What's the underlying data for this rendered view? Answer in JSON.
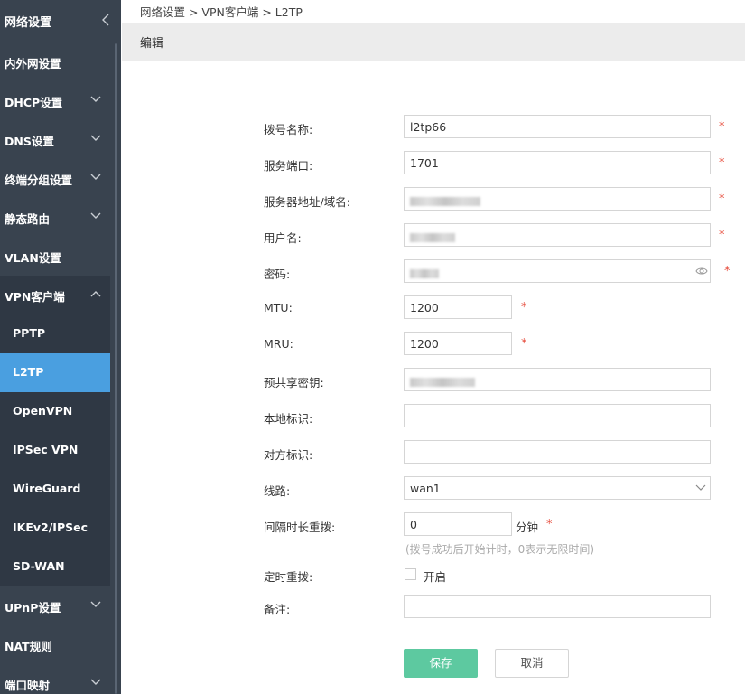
{
  "sidebar": {
    "header": "网络设置",
    "items": [
      {
        "label": "内外网设置"
      },
      {
        "label": "DHCP设置"
      },
      {
        "label": "DNS设置"
      },
      {
        "label": "终端分组设置"
      },
      {
        "label": "静态路由"
      },
      {
        "label": "VLAN设置"
      },
      {
        "label": "VPN客户端"
      },
      {
        "label": "UPnP设置"
      },
      {
        "label": "NAT规则"
      },
      {
        "label": "端口映射"
      }
    ],
    "vpn_sub": [
      {
        "label": "PPTP"
      },
      {
        "label": "L2TP"
      },
      {
        "label": "OpenVPN"
      },
      {
        "label": "IPSec VPN"
      },
      {
        "label": "WireGuard"
      },
      {
        "label": "IKEv2/IPSec"
      },
      {
        "label": "SD-WAN"
      }
    ]
  },
  "breadcrumb": "网络设置 > VPN客户端 > L2TP",
  "panel": {
    "title": "编辑"
  },
  "form": {
    "dial_name": {
      "label": "拨号名称:",
      "value": "l2tp66"
    },
    "server_port": {
      "label": "服务端口:",
      "value": "1701"
    },
    "server_addr": {
      "label": "服务器地址/域名:"
    },
    "username": {
      "label": "用户名:"
    },
    "password": {
      "label": "密码:"
    },
    "mtu": {
      "label": "MTU:",
      "value": "1200"
    },
    "mru": {
      "label": "MRU:",
      "value": "1200"
    },
    "psk": {
      "label": "预共享密钥:"
    },
    "local_id": {
      "label": "本地标识:",
      "value": ""
    },
    "peer_id": {
      "label": "对方标识:",
      "value": ""
    },
    "line": {
      "label": "线路:",
      "value": "wan1"
    },
    "redial_interval": {
      "label": "间隔时长重拨:",
      "value": "0",
      "unit": "分钟",
      "hint": "(拨号成功后开始计时，0表示无限时间)"
    },
    "timed_redial": {
      "label": "定时重拨:",
      "option": "开启"
    },
    "note": {
      "label": "备注:",
      "value": ""
    }
  },
  "required_mark": "*",
  "buttons": {
    "save": "保存",
    "cancel": "取消"
  },
  "colors": {
    "sidebar_bg": "#39434f",
    "active": "#4a9fe0",
    "save": "#5dc9a0",
    "required": "#e74c3c"
  }
}
